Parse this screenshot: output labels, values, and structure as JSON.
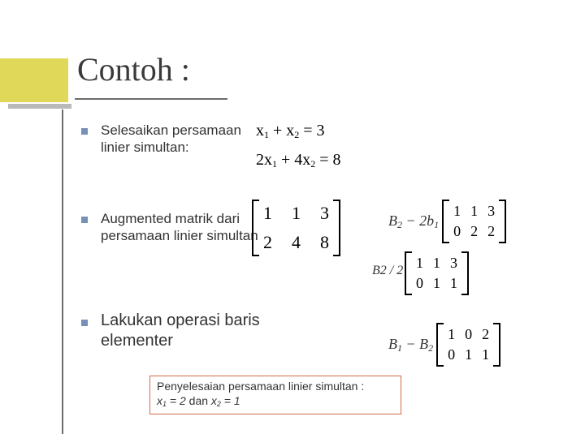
{
  "title": "Contoh :",
  "bullets": {
    "b1": "Selesaikan persamaan linier simultan:",
    "b2": "Augmented matrik dari persamaan linier simultan",
    "b3": "Lakukan operasi baris elementer"
  },
  "equations": {
    "eq1_a": "x",
    "eq1_s1": "1",
    "eq1_b": " + x",
    "eq1_s2": "2",
    "eq1_c": " = 3",
    "eq2_a": "2x",
    "eq2_s1": "1",
    "eq2_b": " + 4x",
    "eq2_s2": "2",
    "eq2_c": " = 8"
  },
  "matrices": {
    "m1": [
      "1",
      "2",
      "1",
      "4",
      "3",
      "8"
    ],
    "m2_label_a": "B",
    "m2_label_s": "2",
    "m2_label_b": " − 2b",
    "m2_label_s2": "1",
    "m2": [
      "1",
      "0",
      "1",
      "2",
      "3",
      "2"
    ],
    "m3_label": "B2 / 2",
    "m3": [
      "1",
      "0",
      "1",
      "1",
      "3",
      "1"
    ],
    "m4_label_a": "B",
    "m4_label_s": "1",
    "m4_label_b": " − B",
    "m4_label_s2": "2",
    "m4": [
      "1",
      "0",
      "0",
      "1",
      "2",
      "1"
    ]
  },
  "solution": {
    "line1": "Penyelesaian persamaan linier simultan :",
    "x1v": "x",
    "x1s": "1",
    "x1eq": " = 2",
    "and": " dan ",
    "x2v": "x",
    "x2s": "2",
    "x2eq": " = 1"
  }
}
